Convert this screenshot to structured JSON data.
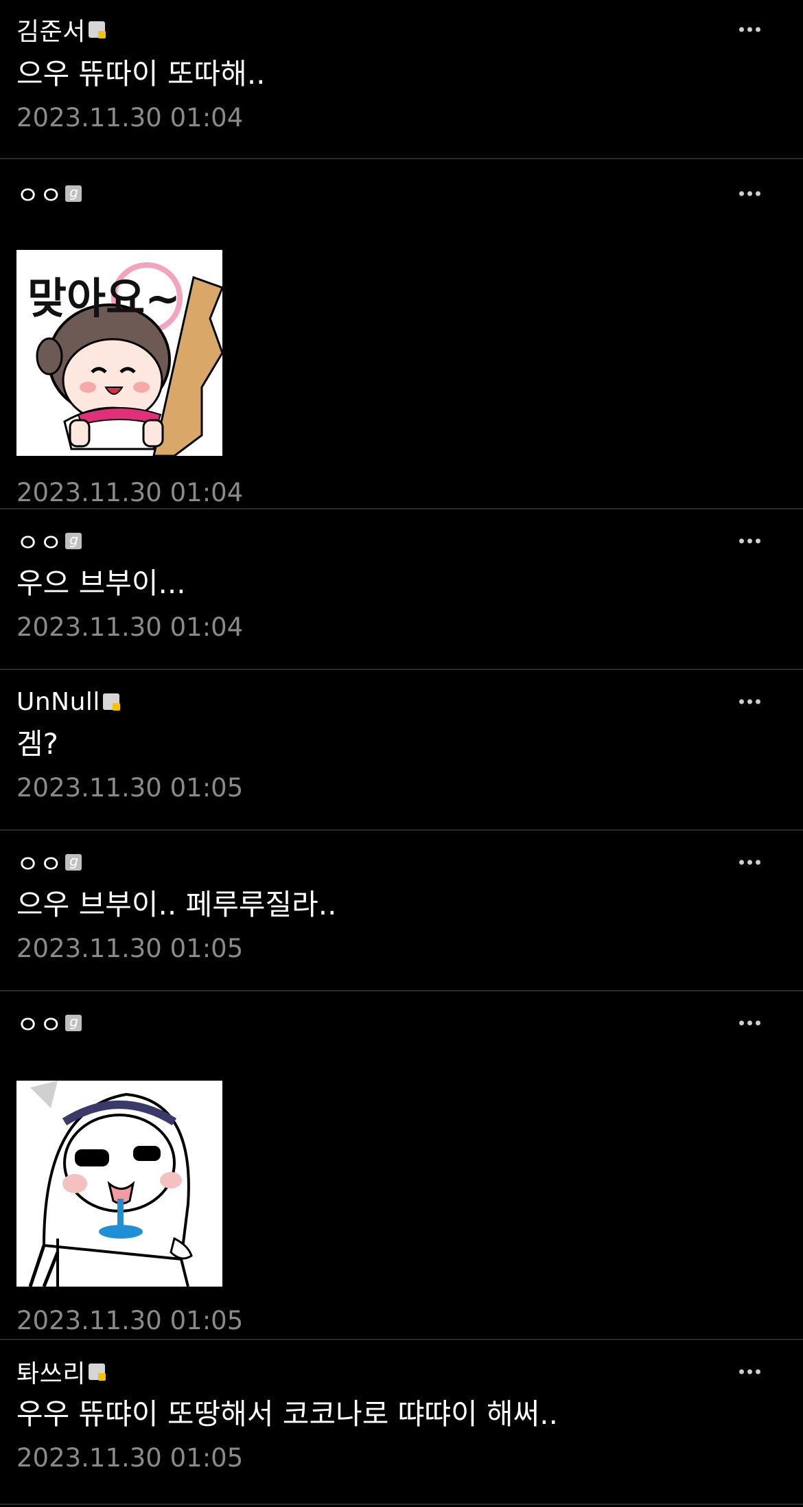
{
  "comments": [
    {
      "author": "김준서",
      "badge": "fixed",
      "text": "으우 뜌따이 또따해..",
      "time": "2023.11.30 01:04"
    },
    {
      "author": "ㅇㅇ",
      "badge": "fluid",
      "sticker": "sticker-maja",
      "sticker_text": "맞아요~",
      "time": "2023.11.30 01:04"
    },
    {
      "author": "ㅇㅇ",
      "badge": "fluid",
      "text": "우으 브부이...",
      "time": "2023.11.30 01:04"
    },
    {
      "author": "UnNull",
      "badge": "fixed",
      "text": "겜?",
      "time": "2023.11.30 01:05"
    },
    {
      "author": "ㅇㅇ",
      "badge": "fluid",
      "text": "으우 브부이.. 페루루질라..",
      "time": "2023.11.30 01:05"
    },
    {
      "author": "ㅇㅇ",
      "badge": "fluid",
      "sticker": "sticker-drool",
      "time": "2023.11.30 01:05"
    },
    {
      "author": "톼쓰리",
      "badge": "fixed",
      "text": "우우 뜌땨이 또땅해서 코코나로 땨땨이 해써..",
      "time": "2023.11.30 01:05"
    }
  ]
}
